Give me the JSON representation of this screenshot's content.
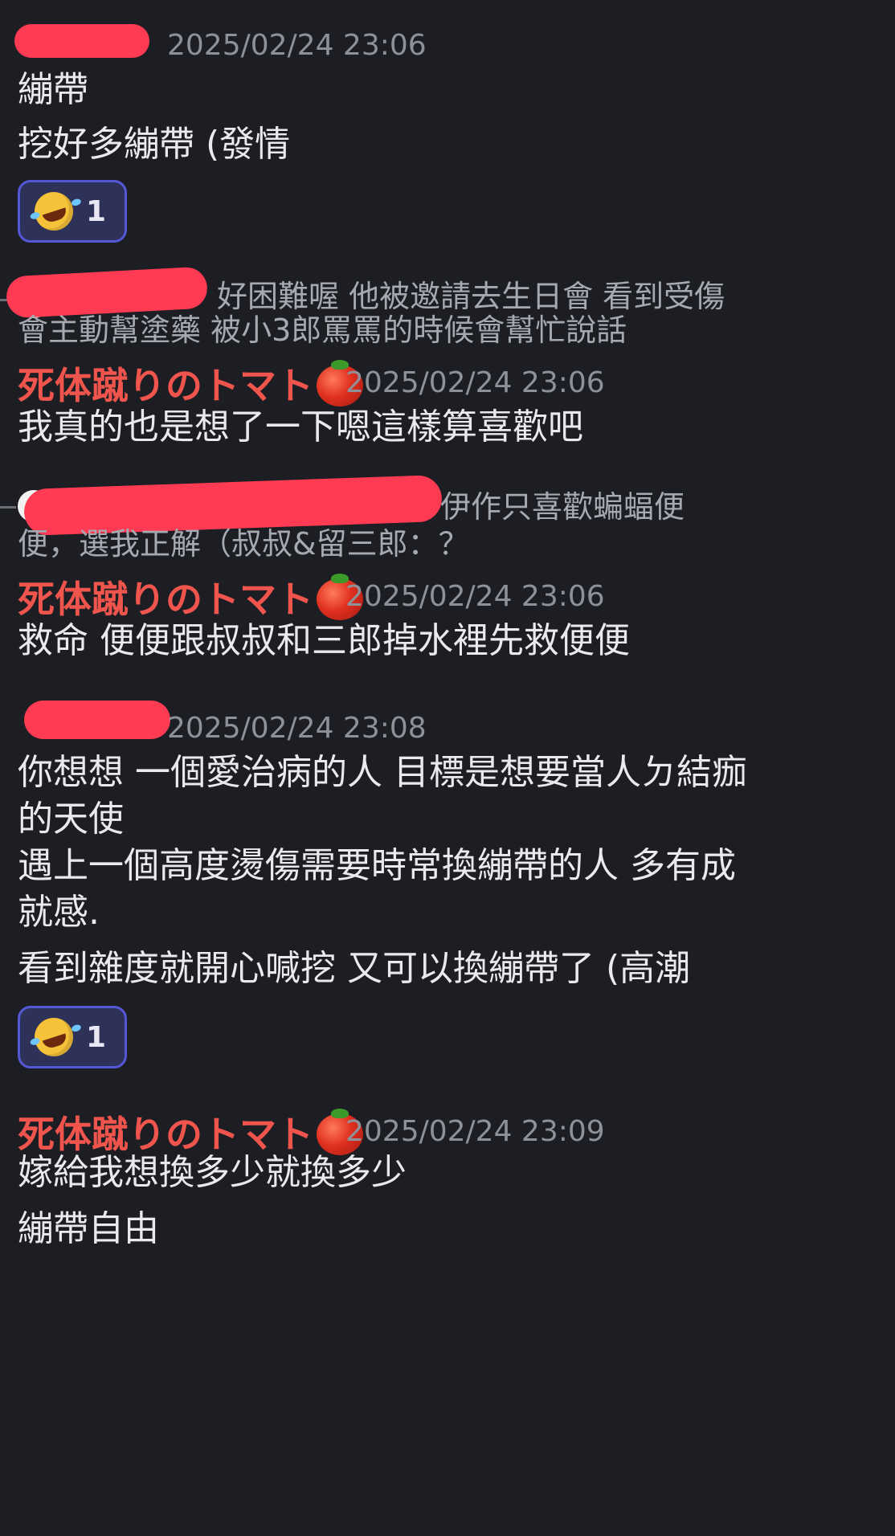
{
  "messages": [
    {
      "author_color": "orange",
      "timestamp": "2025/02/24 23:06",
      "lines": [
        "繃帶",
        "挖好多繃帶 (發情"
      ],
      "reaction": {
        "emoji": "rolling-on-floor-laughing",
        "count": "1"
      }
    },
    {
      "reply_preview": {
        "line1": "好困難喔  他被邀請去生日會 看到受傷",
        "line2": "會主動幫塗藥 被小3郎罵罵的時候會幫忙說話"
      },
      "author": "死体蹴りのトマト",
      "timestamp": "2025/02/24 23:06",
      "lines": [
        "我真的也是想了一下嗯這樣算喜歡吧"
      ]
    },
    {
      "reply_preview": {
        "line1": "伊作只喜歡蝙蝠便",
        "line2": "便，選我正解（叔叔&留三郎：？"
      },
      "author": "死体蹴りのトマト",
      "timestamp": "2025/02/24 23:06",
      "lines": [
        "救命 便便跟叔叔和三郎掉水裡先救便便"
      ]
    },
    {
      "author_color": "orange",
      "timestamp": "2025/02/24 23:08",
      "lines": [
        "你想想 一個愛治病的人 目標是想要當人ㄉ結痂",
        "的天使",
        "遇上一個高度燙傷需要時常換繃帶的人 多有成",
        "就感.",
        "看到雜度就開心喊挖 又可以換繃帶了 (高潮"
      ],
      "reaction": {
        "emoji": "rolling-on-floor-laughing",
        "count": "1"
      }
    },
    {
      "author": "死体蹴りのトマト",
      "timestamp": "2025/02/24 23:09",
      "lines": [
        "嫁給我想換多少就換多少",
        "繃帶自由"
      ]
    }
  ],
  "icons": {
    "author_emoji": "tomato-icon",
    "reaction_emoji": "rolling-on-floor-laughing-icon",
    "reply_avatar": "avatar-icon"
  },
  "colors": {
    "background": "#1d1e23",
    "author_red": "#f0554d",
    "author_orange": "#e6903a",
    "timestamp": "#8e919a",
    "reaction_border": "#5558d6",
    "reaction_fill": "#2e3158",
    "redaction": "#ff3b53"
  }
}
